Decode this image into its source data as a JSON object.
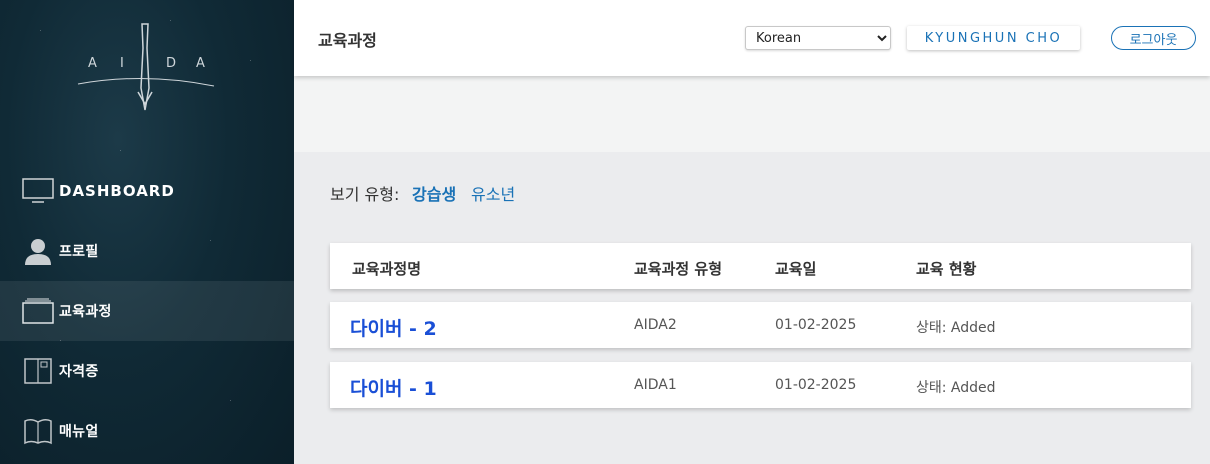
{
  "brand": {
    "logo_letters": [
      "A",
      "I",
      "D",
      "A"
    ]
  },
  "sidebar": {
    "items": [
      {
        "label": "DASHBOARD",
        "icon": "monitor-icon"
      },
      {
        "label": "프로필",
        "icon": "user-icon"
      },
      {
        "label": "교육과정",
        "icon": "course-folder-icon",
        "active": true
      },
      {
        "label": "자격증",
        "icon": "certificate-book-icon"
      },
      {
        "label": "매뉴얼",
        "icon": "open-book-icon"
      }
    ]
  },
  "header": {
    "title": "교육과정",
    "language": {
      "selected": "Korean",
      "options": [
        "Korean"
      ]
    },
    "user_name": "KYUNGHUN CHO",
    "logout_label": "로그아웃"
  },
  "view": {
    "label": "보기 유형:",
    "options": [
      {
        "label": "강습생",
        "active": true
      },
      {
        "label": "유소년",
        "active": false
      }
    ]
  },
  "table": {
    "columns": [
      "교육과정명",
      "교육과정 유형",
      "교육일",
      "교육 현황"
    ],
    "rows": [
      {
        "name": "다이버 - 2",
        "type": "AIDA2",
        "date": "01-02-2025",
        "status": "상태: Added"
      },
      {
        "name": "다이버 - 1",
        "type": "AIDA1",
        "date": "01-02-2025",
        "status": "상태: Added"
      }
    ]
  },
  "colors": {
    "accent": "#1a72b6",
    "course_link": "#1a4fd6",
    "sidebar_bg": "#102a36"
  }
}
